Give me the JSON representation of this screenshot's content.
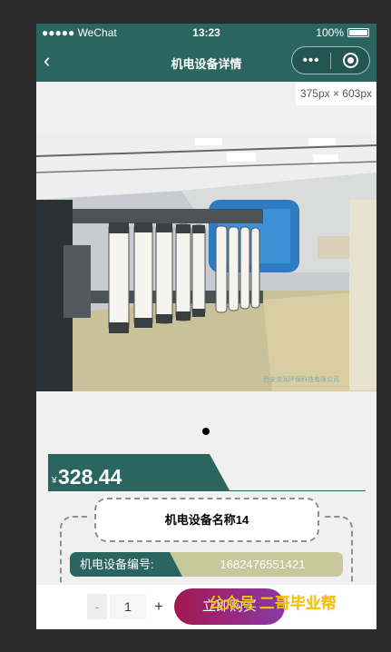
{
  "status_bar": {
    "carrier": "●●●●● WeChat",
    "time": "13:23",
    "battery": "100%"
  },
  "navbar": {
    "back_icon": "‹",
    "title": "机电设备详情",
    "more_icon": "•••"
  },
  "size_tag": "375px × 603px",
  "product": {
    "currency_symbol": "¥",
    "price": "328.44",
    "name": "机电设备名称14",
    "serial_label": "机电设备编号:",
    "serial_value": "1682476551421",
    "image_credit": "西安滨润环保科技有限公司"
  },
  "bottom_bar": {
    "minus": "-",
    "quantity": "1",
    "plus": "+",
    "buy_label": "立即购买"
  },
  "watermark": "公众号 二哥毕业帮",
  "colors": {
    "theme": "#2b6560",
    "serial_bg": "#c9c79c",
    "buy_start": "#a4174f",
    "buy_end": "#8a3aa6",
    "watermark": "#f5c400"
  }
}
